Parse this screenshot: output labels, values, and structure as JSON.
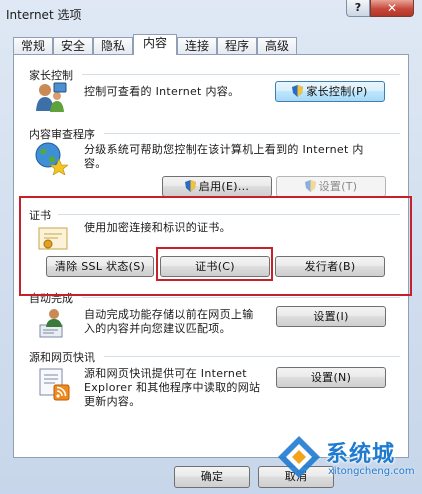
{
  "window": {
    "title": "Internet 选项",
    "help_label": "?",
    "close_label": "✕"
  },
  "tabs": [
    {
      "label": "常规"
    },
    {
      "label": "安全"
    },
    {
      "label": "隐私"
    },
    {
      "label": "内容",
      "active": true
    },
    {
      "label": "连接"
    },
    {
      "label": "程序"
    },
    {
      "label": "高级"
    }
  ],
  "parental": {
    "title": "家长控制",
    "description": "控制可查看的 Internet 内容。",
    "button_label": "家长控制(P)",
    "icon": "parental-control-icon"
  },
  "content_advisor": {
    "title": "内容审查程序",
    "description_line1": "分级系统可帮助您控制在该计算机上看到的 Internet 内",
    "description_line2": "容。",
    "enable_label": "启用(E)...",
    "settings_label": "设置(T)",
    "icon": "content-advisor-globe-icon"
  },
  "certificates": {
    "title": "证书",
    "description": "使用加密连接和标识的证书。",
    "clear_ssl_label": "清除 SSL 状态(S)",
    "certificates_label": "证书(C)",
    "publishers_label": "发行者(B)",
    "icon": "certificate-icon"
  },
  "autocomplete": {
    "title": "自动完成",
    "description_line1": "自动完成功能存储以前在网页上输",
    "description_line2": "入的内容并向您建议匹配项。",
    "settings_label": "设置(I)",
    "icon": "autocomplete-icon"
  },
  "feeds": {
    "title": "源和网页快讯",
    "description_line1": "源和网页快讯提供可在 Internet",
    "description_line2": "Explorer 和其他程序中读取的网站",
    "description_line3": "更新内容。",
    "settings_label": "设置(N)",
    "icon": "feeds-icon"
  },
  "footer": {
    "ok_label": "确定",
    "cancel_label": "取消"
  },
  "watermark": {
    "text": "系统城",
    "url": "xitongcheng.com"
  },
  "colors": {
    "highlight_box": "#c8202a",
    "accent": "#1e7bd0"
  }
}
